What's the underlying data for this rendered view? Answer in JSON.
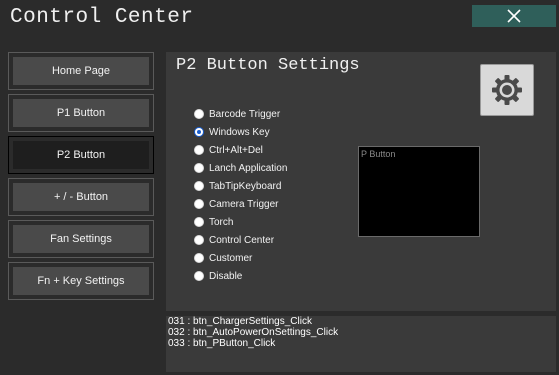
{
  "window": {
    "title": "Control Center",
    "close_icon": "close-icon"
  },
  "sidebar": {
    "items": [
      {
        "label": "Home Page",
        "active": false
      },
      {
        "label": "P1 Button",
        "active": false
      },
      {
        "label": "P2 Button",
        "active": true
      },
      {
        "label": "+ / - Button",
        "active": false
      },
      {
        "label": "Fan Settings",
        "active": false
      },
      {
        "label": "Fn + Key Settings",
        "active": false
      }
    ]
  },
  "panel": {
    "title": "P2 Button Settings",
    "settings_icon": "gear-icon",
    "options": [
      {
        "label": "Barcode Trigger",
        "checked": false
      },
      {
        "label": "Windows Key",
        "checked": true
      },
      {
        "label": "Ctrl+Alt+Del",
        "checked": false
      },
      {
        "label": "Lanch Application",
        "checked": false
      },
      {
        "label": "TabTipKeyboard",
        "checked": false
      },
      {
        "label": "Camera Trigger",
        "checked": false
      },
      {
        "label": "Torch",
        "checked": false
      },
      {
        "label": "Control Center",
        "checked": false
      },
      {
        "label": "Customer",
        "checked": false
      },
      {
        "label": "Disable",
        "checked": false
      }
    ],
    "preview_label": "P Button"
  },
  "log": {
    "lines": [
      "031 : btn_ChargerSettings_Click",
      "032 : btn_AutoPowerOnSettings_Click",
      "033 : btn_PButton_Click"
    ]
  },
  "colors": {
    "background": "#2b2b2b",
    "panel": "#3a3a3a",
    "close_button": "#2f5f5a",
    "radio_selected": "#1a5fd1"
  }
}
